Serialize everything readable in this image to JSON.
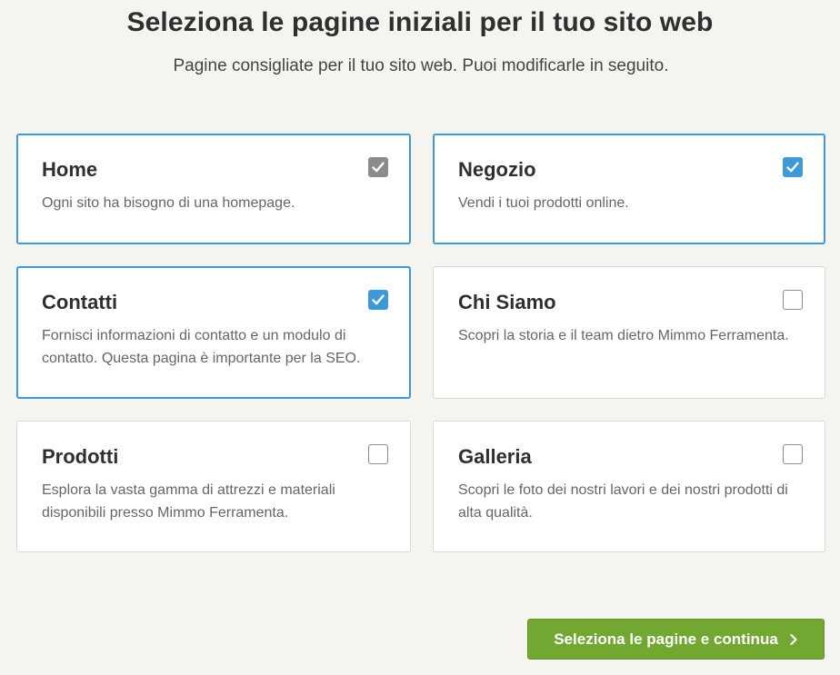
{
  "header": {
    "title": "Seleziona le pagine iniziali per il tuo sito web",
    "subtitle": "Pagine consigliate per il tuo sito web. Puoi modificarle in seguito."
  },
  "pages": [
    {
      "title": "Home",
      "description": "Ogni sito ha bisogno di una homepage.",
      "checked": true,
      "locked": true
    },
    {
      "title": "Negozio",
      "description": "Vendi i tuoi prodotti online.",
      "checked": true,
      "locked": false
    },
    {
      "title": "Contatti",
      "description": "Fornisci informazioni di contatto e un modulo di contatto. Questa pagina è importante per la SEO.",
      "checked": true,
      "locked": false
    },
    {
      "title": "Chi Siamo",
      "description": "Scopri la storia e il team dietro Mimmo Ferramenta.",
      "checked": false,
      "locked": false
    },
    {
      "title": "Prodotti",
      "description": "Esplora la vasta gamma di attrezzi e materiali disponibili presso Mimmo Ferramenta.",
      "checked": false,
      "locked": false
    },
    {
      "title": "Galleria",
      "description": "Scopri le foto dei nostri lavori e dei nostri prodotti di alta qualità.",
      "checked": false,
      "locked": false
    }
  ],
  "footer": {
    "continue_label": "Seleziona le pagine e continua"
  },
  "colors": {
    "accent": "#3d9ad6",
    "locked_check": "#8c8c8c",
    "primary_button": "#72a832",
    "background": "#f5f4ef"
  },
  "icons": {
    "checkbox_checked": "checkmark-icon",
    "continue": "chevron-right-icon"
  }
}
